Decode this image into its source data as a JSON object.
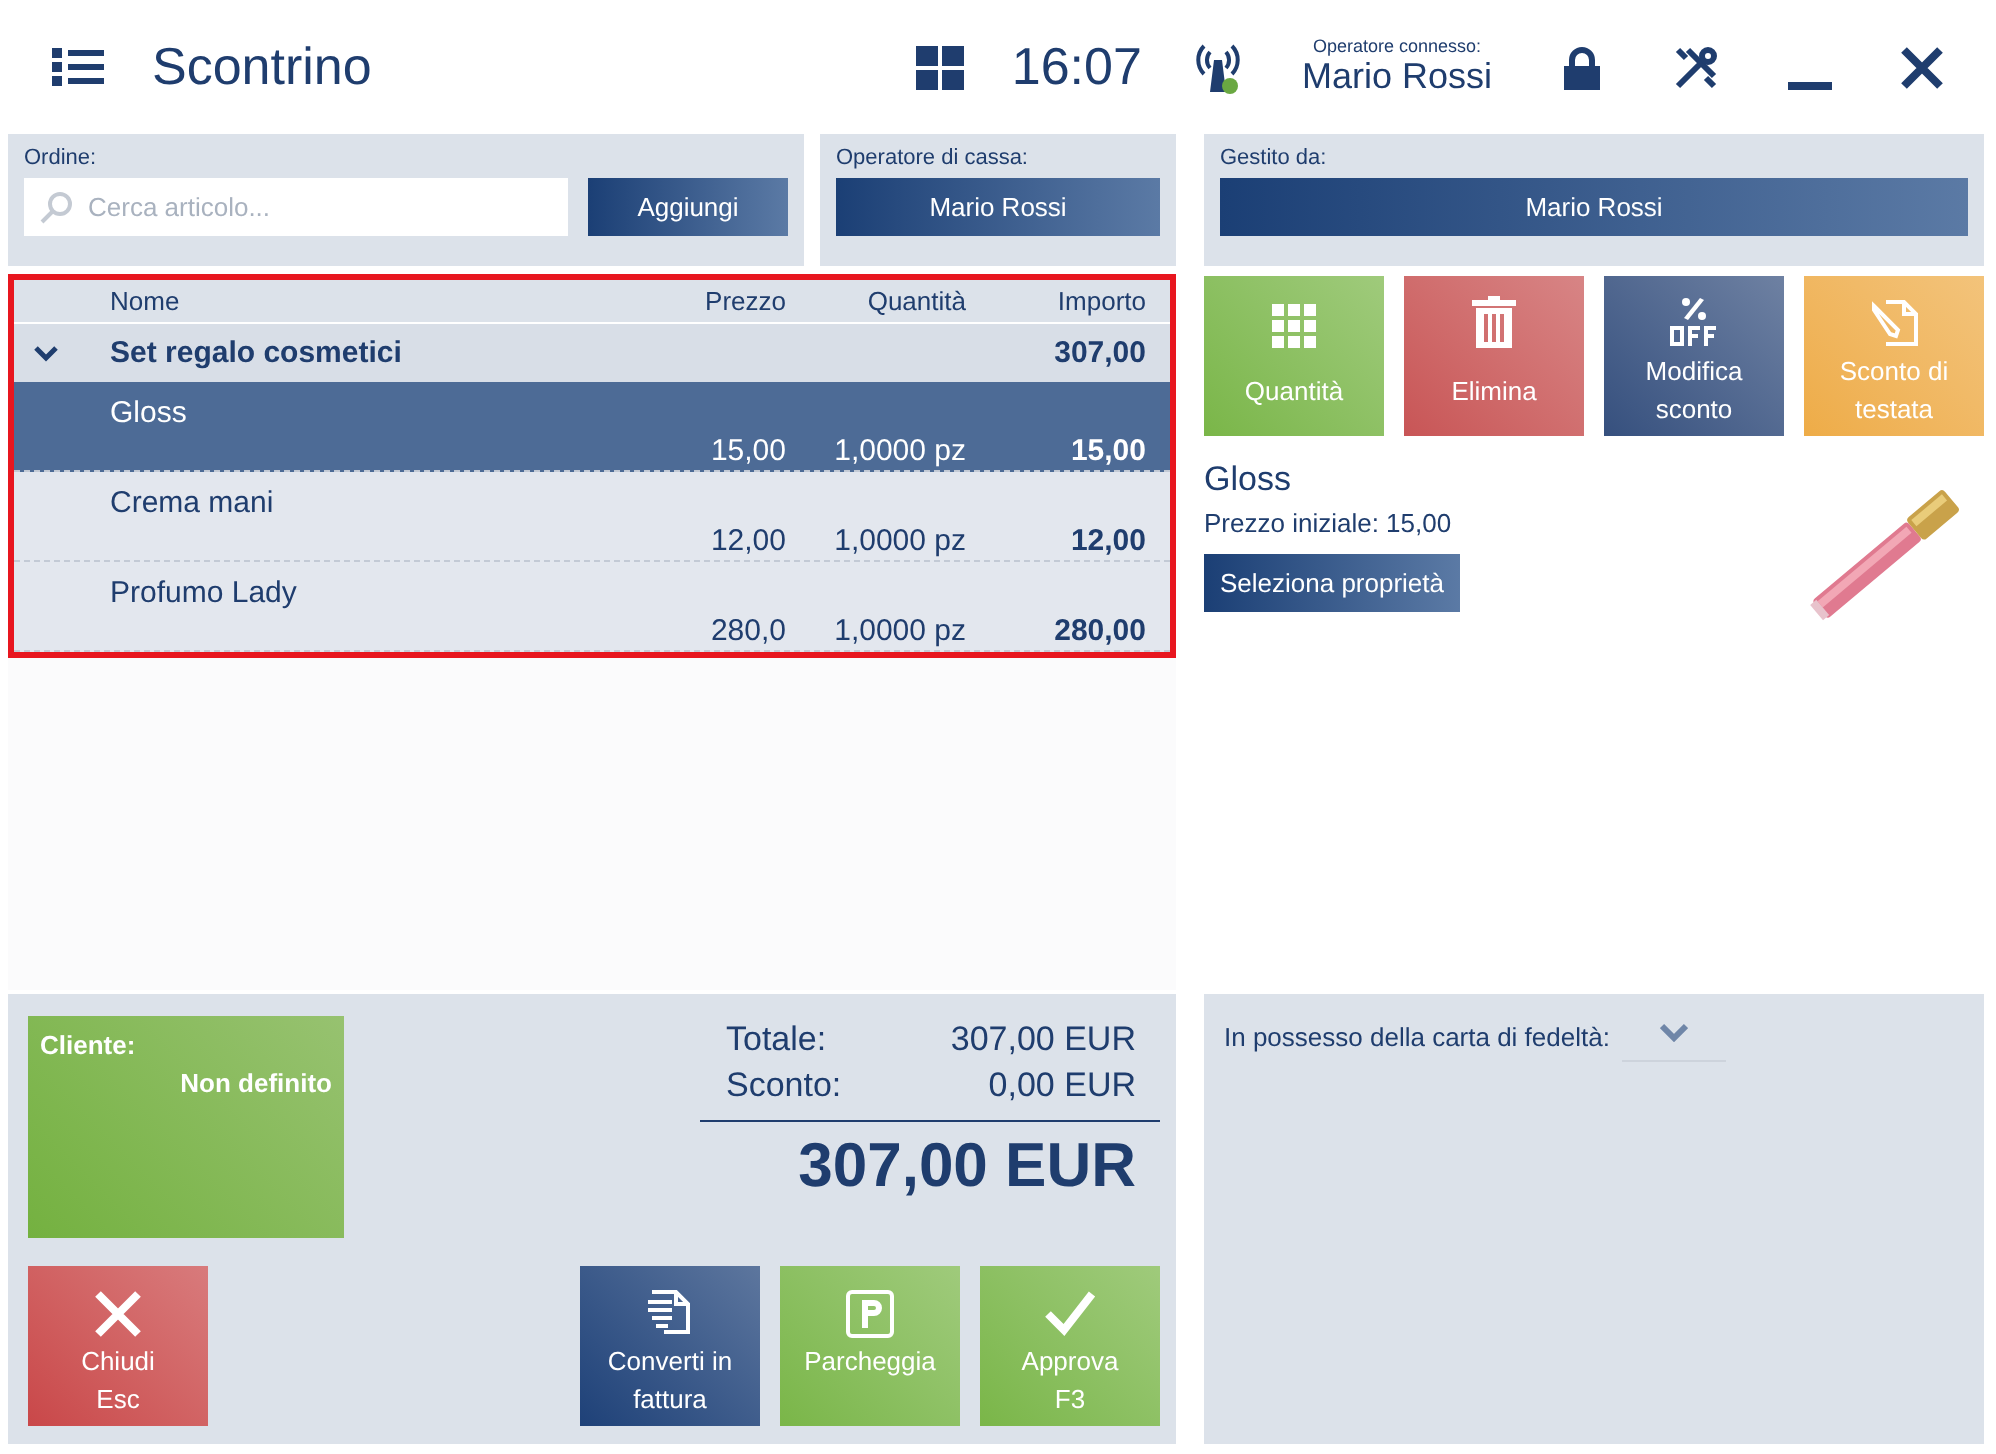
{
  "header": {
    "title": "Scontrino",
    "time": "16:07",
    "operator_label": "Operatore connesso:",
    "operator_name": "Mario Rossi",
    "connected": true
  },
  "order": {
    "label": "Ordine:",
    "search": {
      "placeholder": "Cerca articolo..."
    },
    "add_button": "Aggiungi"
  },
  "cashier": {
    "label": "Operatore di cassa:",
    "value": "Mario Rossi"
  },
  "managed_by": {
    "label": "Gestito da:",
    "value": "Mario Rossi"
  },
  "table": {
    "columns": [
      "Nome",
      "Prezzo",
      "Quantità",
      "Importo"
    ],
    "groups": [
      {
        "name": "Set regalo cosmetici",
        "amount": "307,00",
        "expanded": true,
        "children": [
          {
            "name": "Gloss",
            "price": "15,00",
            "quantity": "1,0000 pz",
            "amount": "15,00",
            "selected": true
          },
          {
            "name": "Crema mani",
            "price": "12,00",
            "quantity": "1,0000 pz",
            "amount": "12,00",
            "selected": false
          },
          {
            "name": "Profumo Lady",
            "price": "280,0",
            "quantity": "1,0000 pz",
            "amount": "280,00",
            "selected": false
          }
        ]
      }
    ]
  },
  "tiles": [
    {
      "kind": "grid",
      "label": "Quantità"
    },
    {
      "kind": "trash",
      "label": "Elimina"
    },
    {
      "kind": "percent",
      "label": "Modifica sconto"
    },
    {
      "kind": "note",
      "label": "Sconto di testata"
    }
  ],
  "product": {
    "name": "Gloss",
    "price": "Prezzo iniziale: 15,00",
    "button": "Seleziona proprietà"
  },
  "customer": {
    "label": "Cliente:",
    "value": "Non definito"
  },
  "totals": [
    {
      "label": "Totale:",
      "value": "307,00 EUR"
    },
    {
      "label": "Sconto:",
      "value": "0,00 EUR"
    }
  ],
  "grand_total": "307,00 EUR",
  "actions": [
    {
      "kind": "close",
      "label": "Chiudi",
      "key": "Esc"
    },
    {
      "kind": "invoice",
      "label": "Converti in fattura"
    },
    {
      "kind": "park",
      "label": "Parcheggia"
    },
    {
      "kind": "check",
      "label": "Approva",
      "key": "F3"
    }
  ],
  "loyalty": {
    "label": "In possesso della carta di fedeltà:"
  }
}
